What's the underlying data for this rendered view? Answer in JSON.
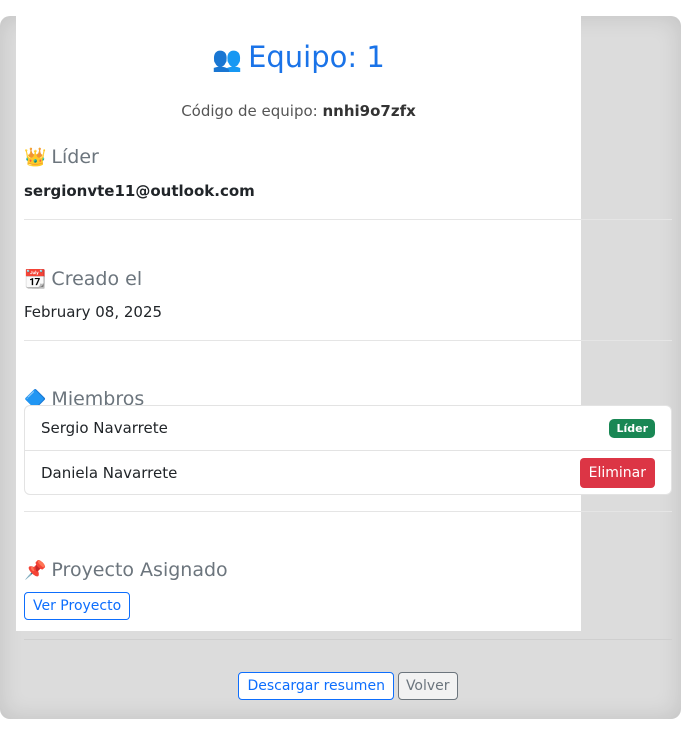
{
  "team": {
    "title": "Equipo: 1",
    "code_label": "Código de equipo:",
    "code_value": "nnhi9o7zfx"
  },
  "leader": {
    "heading": "Líder",
    "email": "sergionvte11@outlook.com"
  },
  "created": {
    "heading": "Creado el",
    "date": "February 08, 2025"
  },
  "members": {
    "heading": "Miembros",
    "items": [
      {
        "name": "Sergio Navarrete",
        "badge": "Líder"
      },
      {
        "name": "Daniela Navarrete",
        "action": "Eliminar"
      }
    ]
  },
  "project": {
    "heading": "Proyecto Asignado",
    "button": "Ver Proyecto"
  },
  "footer": {
    "download": "Descargar resumen",
    "back": "Volver"
  },
  "colors": {
    "primary": "#0d6efd",
    "danger": "#dc3545",
    "success": "#198754",
    "muted": "#6c757d"
  },
  "icons": {
    "team": "team-icon",
    "leader": "crown-icon",
    "created": "calendar-icon",
    "members": "diamond-icon",
    "project": "pushpin-icon"
  }
}
